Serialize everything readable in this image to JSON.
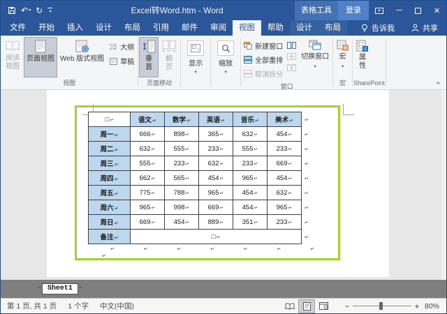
{
  "titlebar": {
    "title": "Excel转Word.htm - Word",
    "table_tools": "表格工具",
    "sign_in": "登录"
  },
  "tabs": {
    "items": [
      {
        "label": "文件"
      },
      {
        "label": "开始"
      },
      {
        "label": "插入"
      },
      {
        "label": "设计"
      },
      {
        "label": "布局"
      },
      {
        "label": "引用"
      },
      {
        "label": "邮件"
      },
      {
        "label": "审阅"
      },
      {
        "label": "视图",
        "active": true
      },
      {
        "label": "帮助"
      },
      {
        "label": "设计",
        "contextual": true
      },
      {
        "label": "布局",
        "contextual": true
      }
    ],
    "tell_me": "告诉我",
    "share": "共享"
  },
  "ribbon": {
    "views": {
      "group_label": "视图",
      "read_mode": "阅读视图",
      "print_layout": "页面视图",
      "web_layout": "Web 版式视图",
      "outline": "大纲",
      "draft": "草稿"
    },
    "page_movement": {
      "group_label": "页面移动",
      "vertical": "垂直",
      "side_to_side": "翻页"
    },
    "show": {
      "label": "显示"
    },
    "zoom": {
      "label": "缩放"
    },
    "window": {
      "group_label": "窗口",
      "new_window": "新建窗口",
      "arrange_all": "全部重排",
      "remove_split": "取消拆分",
      "switch_windows": "切换窗口"
    },
    "macros": {
      "group_label": "宏",
      "button": "宏"
    },
    "sharepoint": {
      "group_label": "SharePoint",
      "properties": "属性"
    }
  },
  "document": {
    "sheet_tab": "Sheet1",
    "table": {
      "corner": "□",
      "mark": "↵",
      "columns": [
        "语文",
        "数学",
        "英语",
        "音乐",
        "美术"
      ],
      "rows": [
        [
          "周一",
          666,
          898,
          365,
          632,
          454
        ],
        [
          "周二",
          632,
          555,
          233,
          555,
          233
        ],
        [
          "周三",
          555,
          233,
          632,
          233,
          669
        ],
        [
          "周四",
          662,
          565,
          454,
          965,
          454
        ],
        [
          "周五",
          775,
          788,
          965,
          454,
          632
        ],
        [
          "周六",
          965,
          998,
          669,
          454,
          965
        ],
        [
          "周日",
          669,
          454,
          889,
          351,
          233
        ]
      ],
      "footer": {
        "label": "备注",
        "value": "□"
      }
    }
  },
  "statusbar": {
    "page_info": "第 1 页, 共 1 页",
    "words": "1 个字",
    "language": "中文(中国)",
    "zoom_minus": "−",
    "zoom_plus": "+",
    "zoom": "80%"
  },
  "colors": {
    "titlebar_blue": "#2b579a",
    "table_header_blue": "#bdd7ee",
    "selection_green": "#a2d333",
    "band_gray": "#7f7f7f"
  }
}
